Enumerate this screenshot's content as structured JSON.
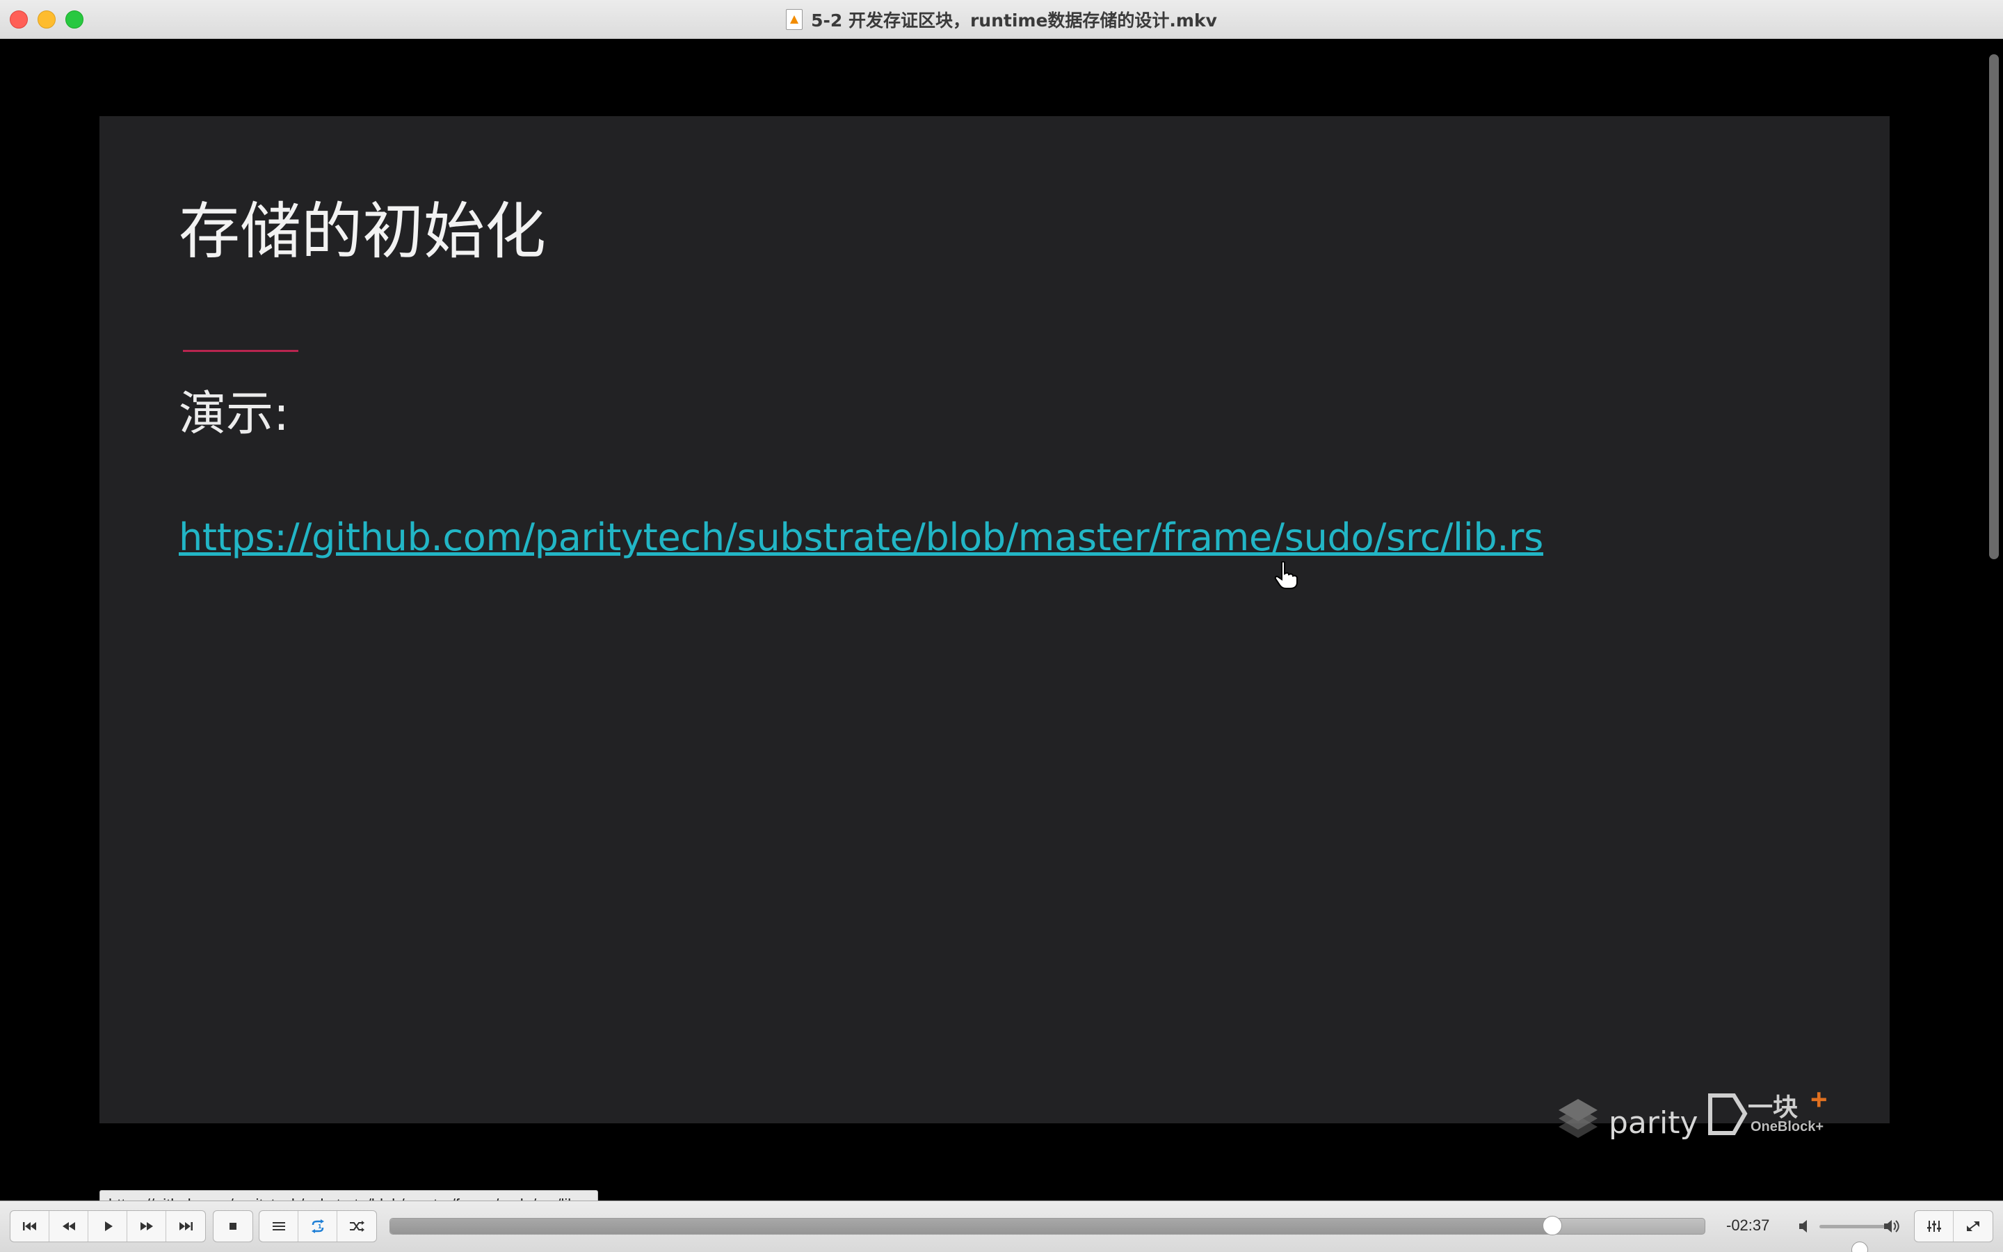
{
  "window": {
    "title": "5-2 开发存证区块，runtime数据存储的设计.mkv"
  },
  "slide": {
    "title": "存储的初始化",
    "demo_label": "演示:",
    "link": "https://github.com/paritytech/substrate/blob/master/frame/sudo/src/lib.rs",
    "logo_parity": "parity",
    "logo_oneblock_cn": "一块",
    "logo_oneblock_plus": "+",
    "logo_oneblock_en": "OneBlock+"
  },
  "tooltip": {
    "url": "https://github.com/paritytech/substrate/blob/master/frame/sudo/src/lib..."
  },
  "controls": {
    "time_remaining": "-02:37",
    "progress_fraction": 0.884,
    "volume_fraction": 0.62,
    "icons": [
      "skip-back-icon",
      "rewind-icon",
      "play-icon",
      "fast-forward-icon",
      "skip-forward-icon",
      "stop-icon",
      "playlist-icon",
      "loop-icon",
      "shuffle-icon",
      "equalizer-icon",
      "fullscreen-icon"
    ],
    "loop_color": "#1e7fd6"
  }
}
